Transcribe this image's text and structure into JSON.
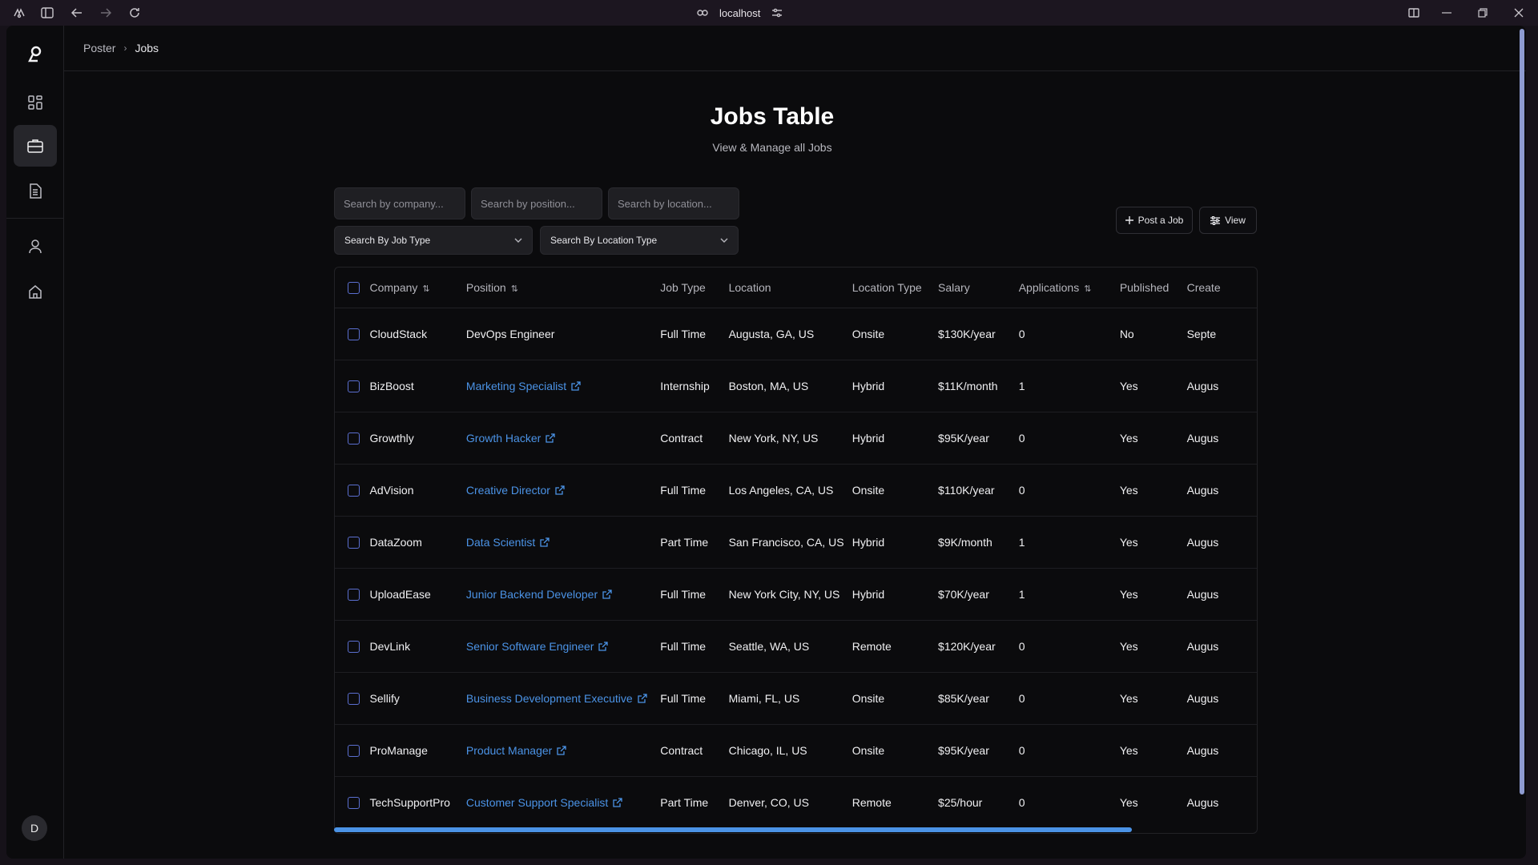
{
  "browser": {
    "address": "localhost"
  },
  "breadcrumb": {
    "root": "Poster",
    "current": "Jobs"
  },
  "page": {
    "title": "Jobs Table",
    "subtitle": "View & Manage all Jobs"
  },
  "filters": {
    "company_placeholder": "Search by company...",
    "position_placeholder": "Search by position...",
    "location_placeholder": "Search by location...",
    "job_type_select": "Search By Job Type",
    "location_type_select": "Search By Location Type"
  },
  "actions": {
    "post_job": "Post a Job",
    "view": "View"
  },
  "user": {
    "initial": "D"
  },
  "table": {
    "headers": {
      "company": "Company",
      "position": "Position",
      "job_type": "Job Type",
      "location": "Location",
      "location_type": "Location Type",
      "salary": "Salary",
      "applications": "Applications",
      "published": "Published",
      "created": "Create"
    },
    "rows": [
      {
        "company": "CloudStack",
        "position": "DevOps Engineer",
        "linked": false,
        "job_type": "Full Time",
        "location": "Augusta, GA, US",
        "location_type": "Onsite",
        "salary": "$130K/year",
        "applications": "0",
        "published": "No",
        "created": "Septe"
      },
      {
        "company": "BizBoost",
        "position": "Marketing Specialist",
        "linked": true,
        "job_type": "Internship",
        "location": "Boston, MA, US",
        "location_type": "Hybrid",
        "salary": "$11K/month",
        "applications": "1",
        "published": "Yes",
        "created": "Augus"
      },
      {
        "company": "Growthly",
        "position": "Growth Hacker",
        "linked": true,
        "job_type": "Contract",
        "location": "New York, NY, US",
        "location_type": "Hybrid",
        "salary": "$95K/year",
        "applications": "0",
        "published": "Yes",
        "created": "Augus"
      },
      {
        "company": "AdVision",
        "position": "Creative Director",
        "linked": true,
        "job_type": "Full Time",
        "location": "Los Angeles, CA, US",
        "location_type": "Onsite",
        "salary": "$110K/year",
        "applications": "0",
        "published": "Yes",
        "created": "Augus"
      },
      {
        "company": "DataZoom",
        "position": "Data Scientist",
        "linked": true,
        "job_type": "Part Time",
        "location": "San Francisco, CA, US",
        "location_type": "Hybrid",
        "salary": "$9K/month",
        "applications": "1",
        "published": "Yes",
        "created": "Augus"
      },
      {
        "company": "UploadEase",
        "position": "Junior Backend Developer",
        "linked": true,
        "job_type": "Full Time",
        "location": "New York City, NY, US",
        "location_type": "Hybrid",
        "salary": "$70K/year",
        "applications": "1",
        "published": "Yes",
        "created": "Augus"
      },
      {
        "company": "DevLink",
        "position": "Senior Software Engineer",
        "linked": true,
        "job_type": "Full Time",
        "location": "Seattle, WA, US",
        "location_type": "Remote",
        "salary": "$120K/year",
        "applications": "0",
        "published": "Yes",
        "created": "Augus"
      },
      {
        "company": "Sellify",
        "position": "Business Development Executive",
        "linked": true,
        "job_type": "Full Time",
        "location": "Miami, FL, US",
        "location_type": "Onsite",
        "salary": "$85K/year",
        "applications": "0",
        "published": "Yes",
        "created": "Augus"
      },
      {
        "company": "ProManage",
        "position": "Product Manager",
        "linked": true,
        "job_type": "Contract",
        "location": "Chicago, IL, US",
        "location_type": "Onsite",
        "salary": "$95K/year",
        "applications": "0",
        "published": "Yes",
        "created": "Augus"
      },
      {
        "company": "TechSupportPro",
        "position": "Customer Support Specialist",
        "linked": true,
        "job_type": "Part Time",
        "location": "Denver, CO, US",
        "location_type": "Remote",
        "salary": "$25/hour",
        "applications": "0",
        "published": "Yes",
        "created": "Augus"
      }
    ]
  },
  "colors": {
    "link": "#4b93e6",
    "checkbox": "#5b6fd0",
    "scrollbar": "#4b93e6"
  }
}
